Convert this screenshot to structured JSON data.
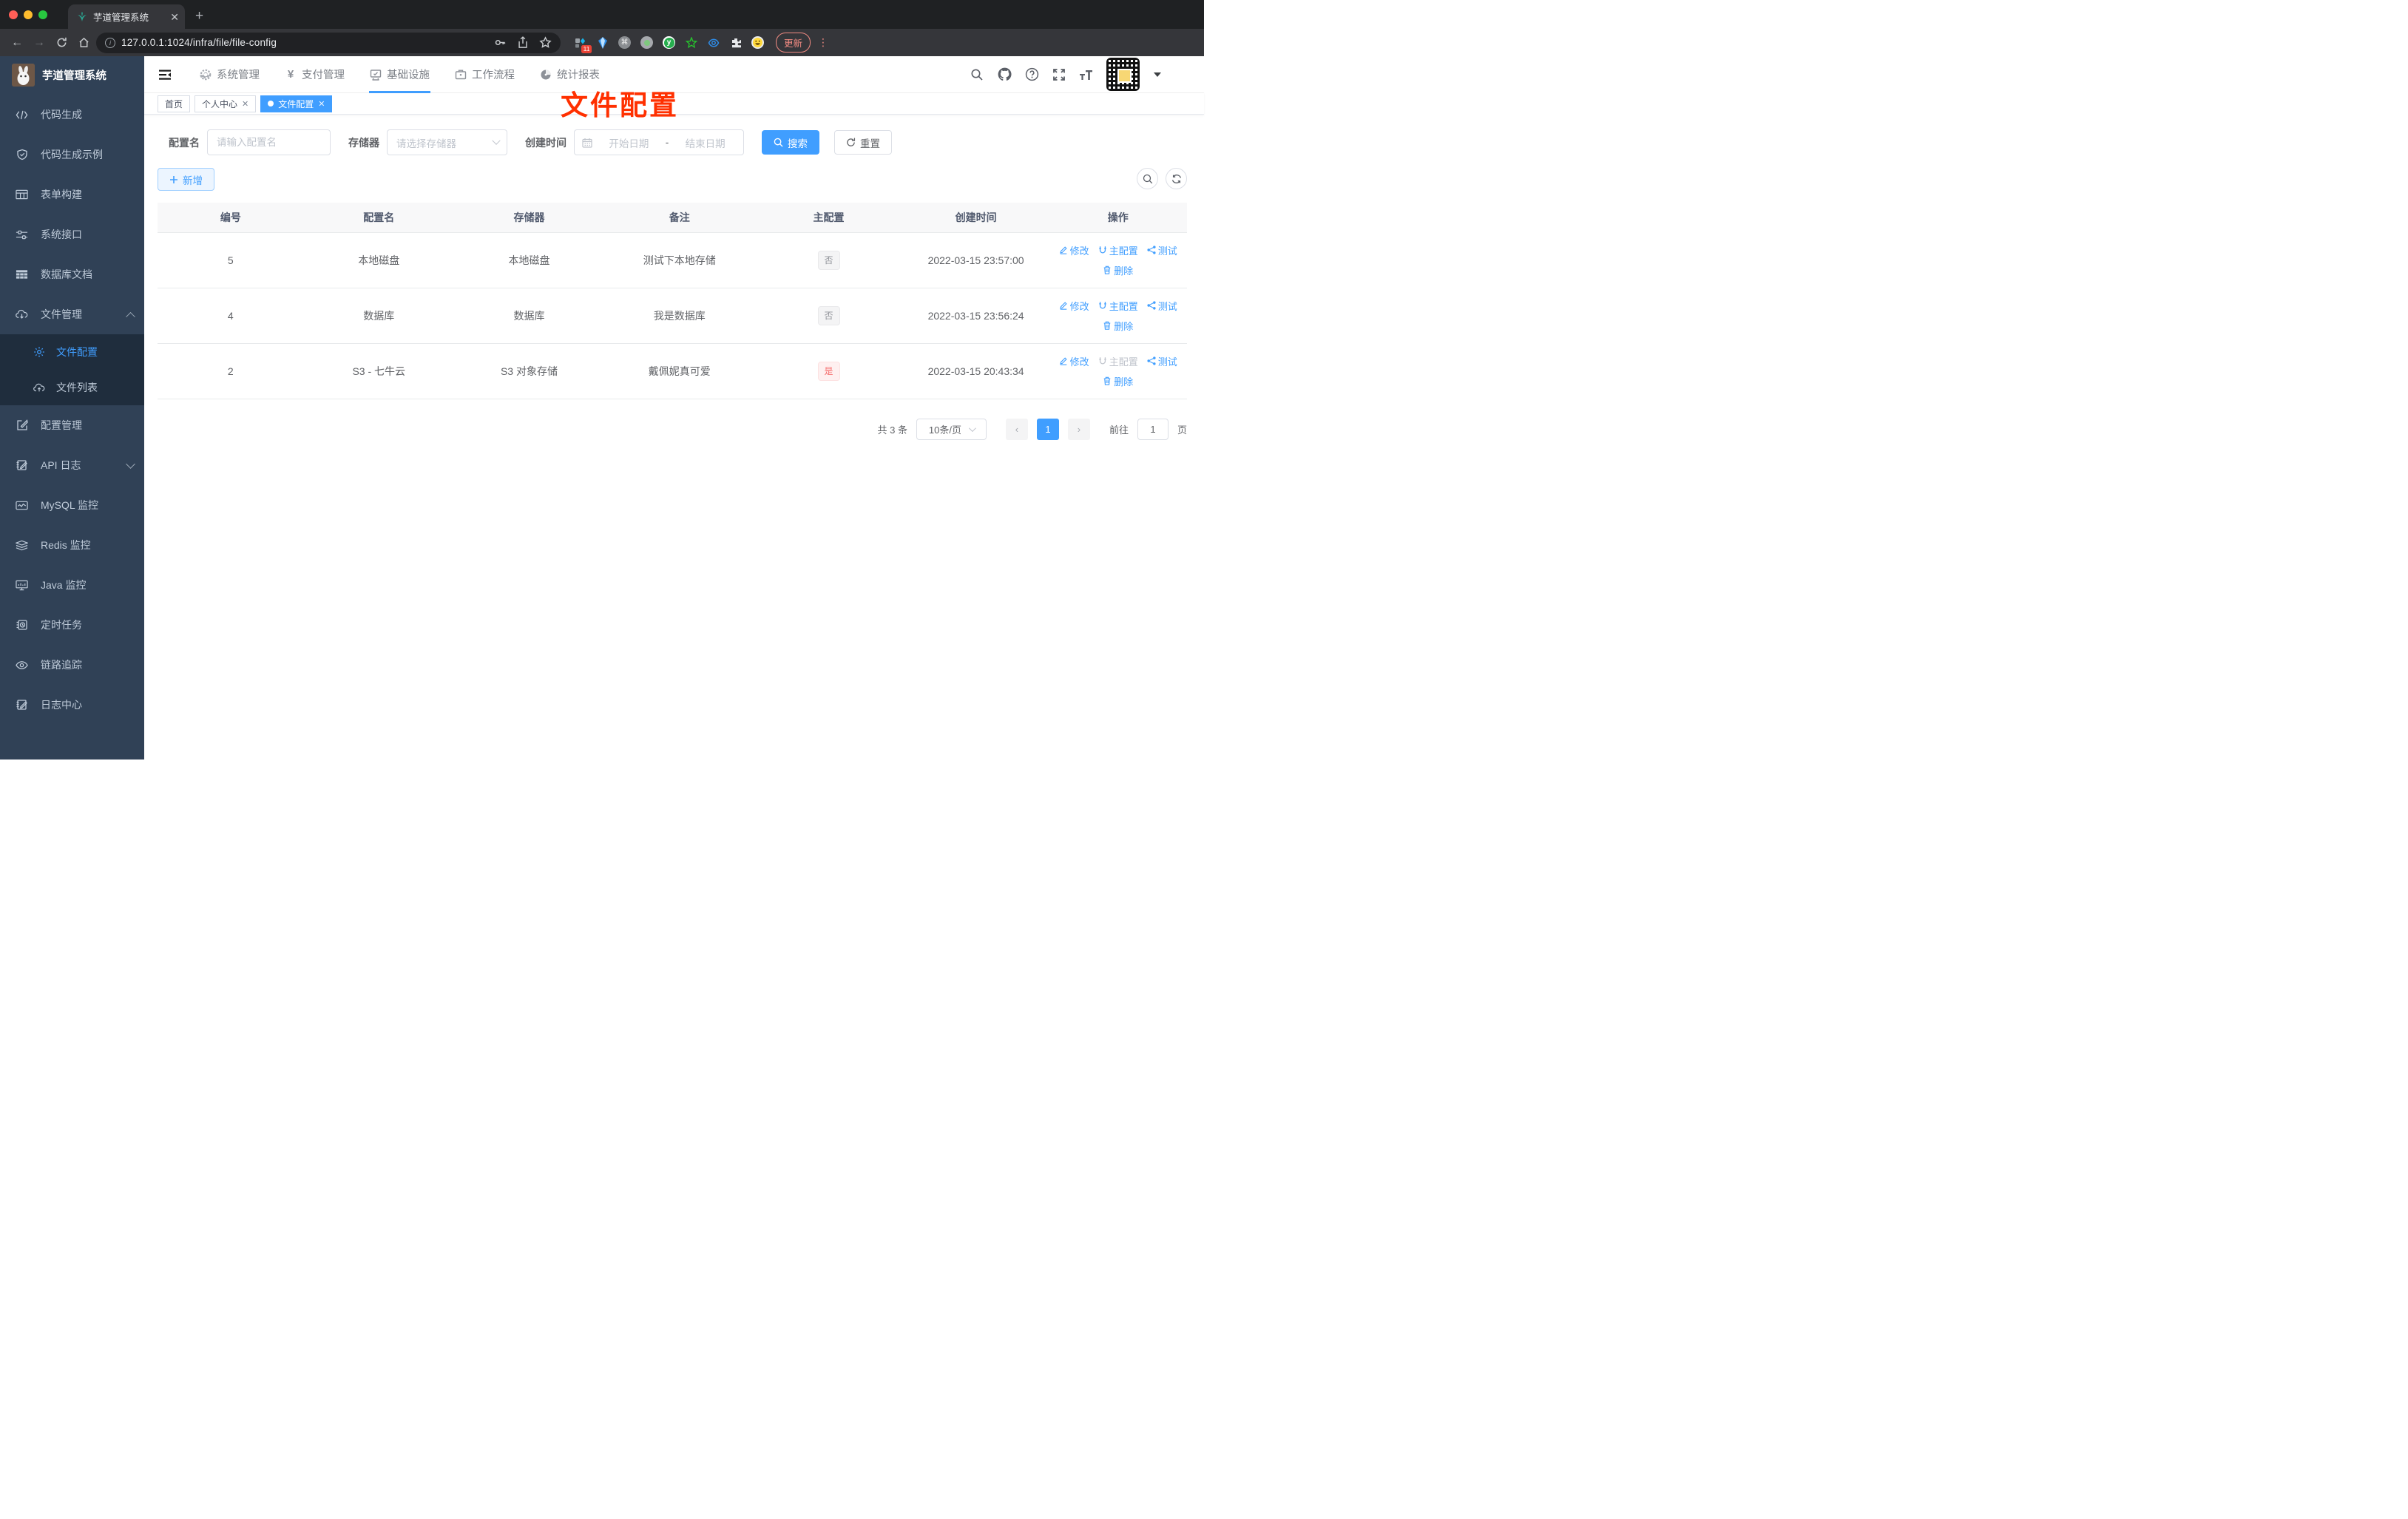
{
  "colors": {
    "accent": "#409eff",
    "danger": "#f56c6c",
    "overlay_red": "#ff3000",
    "sidebar_bg": "#304156",
    "submenu_bg": "#1f2d3d"
  },
  "browser": {
    "tab": {
      "title": "芋道管理系统"
    },
    "url": "127.0.0.1:1024/infra/file/file-config",
    "extensions_badge": "11",
    "update_label": "更新"
  },
  "sidebar": {
    "title": "芋道管理系统",
    "items": [
      {
        "label": "代码生成",
        "icon": "code-icon"
      },
      {
        "label": "代码生成示例",
        "icon": "shield-check-icon"
      },
      {
        "label": "表单构建",
        "icon": "form-grid-icon"
      },
      {
        "label": "系统接口",
        "icon": "sliders-icon"
      },
      {
        "label": "数据库文档",
        "icon": "table-icon"
      },
      {
        "label": "文件管理",
        "icon": "cloud-download-icon"
      }
    ],
    "file_children": [
      {
        "label": "文件配置",
        "icon": "gear-icon",
        "active": true
      },
      {
        "label": "文件列表",
        "icon": "cloud-upload-icon",
        "active": false
      }
    ],
    "items2": [
      {
        "label": "配置管理",
        "icon": "edit-square-icon"
      },
      {
        "label": "API 日志",
        "icon": "log-edit-icon"
      },
      {
        "label": "MySQL 监控",
        "icon": "chart-line-icon"
      },
      {
        "label": "Redis 监控",
        "icon": "layers-icon"
      },
      {
        "label": "Java 监控",
        "icon": "monitor-icon"
      },
      {
        "label": "定时任务",
        "icon": "schedule-icon"
      },
      {
        "label": "链路追踪",
        "icon": "eye-icon"
      },
      {
        "label": "日志中心",
        "icon": "log-center-icon"
      }
    ]
  },
  "topnav": {
    "menus": [
      {
        "label": "系统管理",
        "icon": "gear-icon"
      },
      {
        "label": "支付管理",
        "icon": "yen-icon"
      },
      {
        "label": "基础设施",
        "icon": "monitor-check-icon",
        "active": true
      },
      {
        "label": "工作流程",
        "icon": "briefcase-icon"
      },
      {
        "label": "统计报表",
        "icon": "dashboard-icon"
      }
    ]
  },
  "tags": {
    "home": "首页",
    "profile": "个人中心",
    "current": "文件配置"
  },
  "overlay_title": "文件配置",
  "filter": {
    "name_label": "配置名",
    "name_placeholder": "请输入配置名",
    "storage_label": "存储器",
    "storage_placeholder": "请选择存储器",
    "date_label": "创建时间",
    "date_start_placeholder": "开始日期",
    "date_separator": "-",
    "date_end_placeholder": "结束日期",
    "search_label": "搜索",
    "reset_label": "重置"
  },
  "toolbar": {
    "add_label": "新增"
  },
  "table": {
    "headers": [
      "编号",
      "配置名",
      "存储器",
      "备注",
      "主配置",
      "创建时间",
      "操作"
    ],
    "action_labels": {
      "edit": "修改",
      "master": "主配置",
      "test": "测试",
      "delete": "删除"
    },
    "rows": [
      {
        "id": "5",
        "name": "本地磁盘",
        "storage": "本地磁盘",
        "remark": "测试下本地存储",
        "master": "否",
        "created": "2022-03-15 23:57:00"
      },
      {
        "id": "4",
        "name": "数据库",
        "storage": "数据库",
        "remark": "我是数据库",
        "master": "否",
        "created": "2022-03-15 23:56:24"
      },
      {
        "id": "2",
        "name": "S3 - 七牛云",
        "storage": "S3 对象存储",
        "remark": "戴佩妮真可爱",
        "master": "是",
        "created": "2022-03-15 20:43:34"
      }
    ]
  },
  "pagination": {
    "total": "共 3 条",
    "page_size": "10条/页",
    "current_page": "1",
    "goto_prefix": "前往",
    "goto_value": "1",
    "goto_suffix": "页"
  }
}
